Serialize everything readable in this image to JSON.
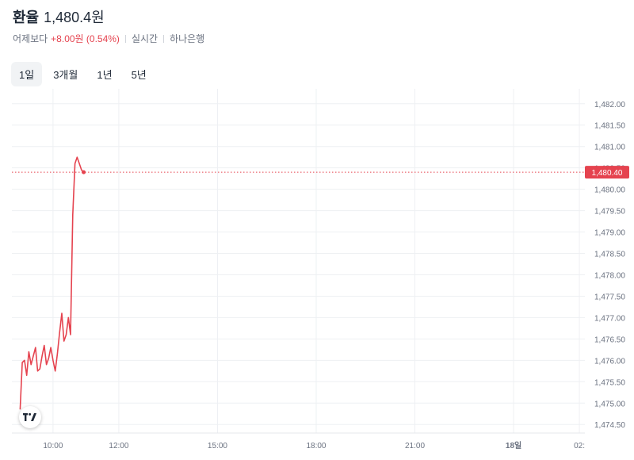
{
  "header": {
    "title": "환율",
    "price": "1,480.4원",
    "compare_label": "어제보다",
    "change": "+8.00원 (0.54%)",
    "mode": "실시간",
    "source": "하나은행"
  },
  "tabs": [
    {
      "label": "1일",
      "active": true
    },
    {
      "label": "3개월",
      "active": false
    },
    {
      "label": "1년",
      "active": false
    },
    {
      "label": "5년",
      "active": false
    }
  ],
  "colors": {
    "line": "#e5434f",
    "grid": "#eef0f3",
    "axis_text": "#6b7280"
  },
  "chart_data": {
    "type": "line",
    "title": "",
    "xlabel": "",
    "ylabel": "",
    "ylim": [
      1474.3,
      1482.2
    ],
    "x_tick_labels": [
      "10:00",
      "12:00",
      "15:00",
      "18:00",
      "21:00",
      "18일",
      "02:"
    ],
    "y_tick_labels": [
      "1,482.00",
      "1,481.50",
      "1,481.00",
      "1,480.50",
      "1,480.00",
      "1,479.50",
      "1,479.00",
      "1,478.50",
      "1,478.00",
      "1,477.50",
      "1,477.00",
      "1,476.50",
      "1,476.00",
      "1,475.50",
      "1,475.00",
      "1,474.50"
    ],
    "y_tick_values": [
      1482.0,
      1481.5,
      1481.0,
      1480.5,
      1480.0,
      1479.5,
      1479.0,
      1478.5,
      1478.0,
      1477.5,
      1477.0,
      1476.5,
      1476.0,
      1475.5,
      1475.0,
      1474.5
    ],
    "last_value": 1480.4,
    "last_value_label": "1,480.40",
    "grid": true,
    "series": [
      {
        "x": [
          "09:00",
          "09:04",
          "09:08",
          "09:12",
          "09:16",
          "09:20",
          "09:24",
          "09:28",
          "09:32",
          "09:36",
          "09:40",
          "09:44",
          "09:48",
          "09:52",
          "09:56",
          "10:00",
          "10:04",
          "10:08",
          "10:12",
          "10:16",
          "10:20",
          "10:24",
          "10:28",
          "10:32",
          "10:36",
          "10:40",
          "10:44",
          "10:48",
          "10:52",
          "10:56",
          "11:00",
          "11:04",
          "11:08",
          "11:12",
          "11:16",
          "11:20",
          "11:24"
        ],
        "values": [
          1474.85,
          1475.95,
          1476.0,
          1475.65,
          1476.2,
          1475.9,
          1476.1,
          1476.3,
          1475.75,
          1475.8,
          1476.1,
          1476.35,
          1475.9,
          1476.05,
          1476.3,
          1476.0,
          1475.75,
          1476.15,
          1476.65,
          1477.1,
          1476.45,
          1476.6,
          1477.0,
          1476.6,
          1479.4,
          1480.6,
          1480.75,
          1480.6,
          1480.45,
          1480.4,
          1480.4,
          1480.4,
          1480.4,
          1480.4,
          1480.4,
          1480.4,
          1480.4
        ]
      }
    ]
  },
  "logo": "tradingview-logo"
}
